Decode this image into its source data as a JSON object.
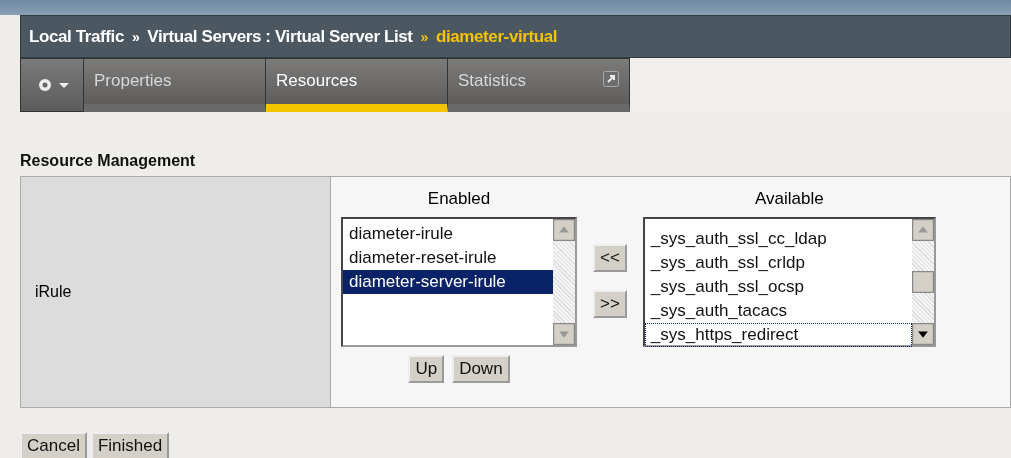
{
  "breadcrumb": {
    "parts": [
      "Local Traffic",
      "Virtual Servers : Virtual Server List"
    ],
    "separator": "»",
    "current": "diameter-virtual"
  },
  "tabs": [
    {
      "label": "Properties",
      "selected": false,
      "external": false
    },
    {
      "label": "Resources",
      "selected": true,
      "external": false
    },
    {
      "label": "Statistics",
      "selected": false,
      "external": true
    }
  ],
  "section_title": "Resource Management",
  "irule": {
    "label": "iRule",
    "enabled": {
      "title": "Enabled",
      "items": [
        {
          "label": "diameter-irule",
          "selected": false
        },
        {
          "label": "diameter-reset-irule",
          "selected": false
        },
        {
          "label": "diameter-server-irule",
          "selected": true
        }
      ]
    },
    "move_buttons": [
      "<<",
      ">>"
    ],
    "order_buttons": [
      "Up",
      "Down"
    ],
    "available": {
      "title": "Available",
      "items": [
        {
          "label": "_sys_auth_ssl_cc_ldap",
          "focused": false
        },
        {
          "label": "_sys_auth_ssl_crldp",
          "focused": false
        },
        {
          "label": "_sys_auth_ssl_ocsp",
          "focused": false
        },
        {
          "label": "_sys_auth_tacacs",
          "focused": false
        },
        {
          "label": "_sys_https_redirect",
          "focused": true
        }
      ]
    }
  },
  "buttons": [
    "Cancel",
    "Finished"
  ]
}
